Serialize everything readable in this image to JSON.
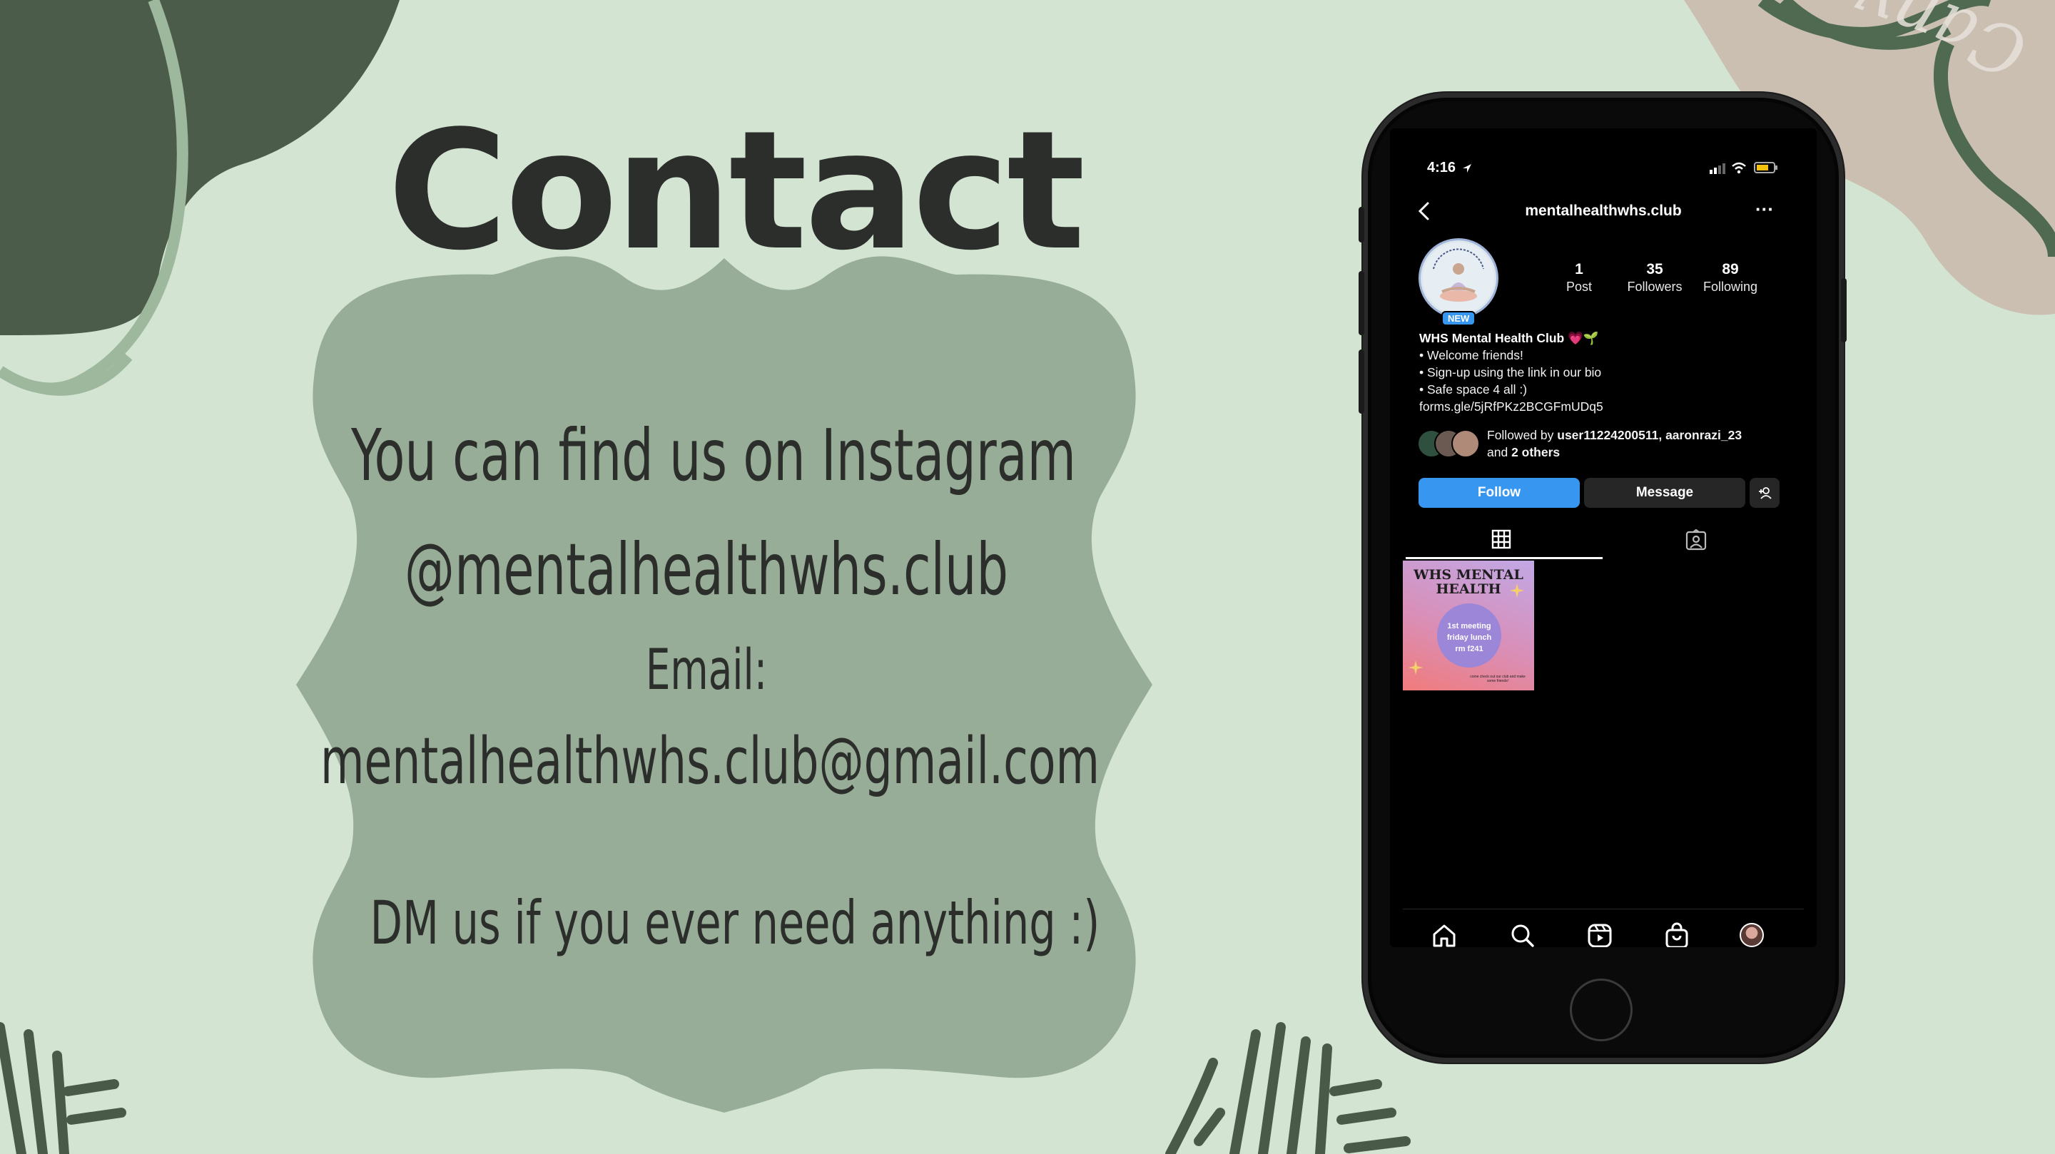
{
  "slide": {
    "title": "Contact",
    "line1": "You can find us on Instagram",
    "line2": "@mentalhealthwhs.club",
    "line3": "Email:",
    "line4": "mentalhealthwhs.club@gmail.com",
    "line5": "DM us if you ever need anything :)",
    "watermark": "Canva"
  },
  "phone": {
    "status": {
      "time": "4:16"
    },
    "header": {
      "username": "mentalhealthwhs.club",
      "more": "···"
    },
    "profile": {
      "avatar_text": "WHS Mental Health Club",
      "new_badge": "NEW",
      "stats": [
        {
          "value": "1",
          "label": "Post"
        },
        {
          "value": "35",
          "label": "Followers"
        },
        {
          "value": "89",
          "label": "Following"
        }
      ],
      "name": "WHS Mental Health Club 💗🌱",
      "bio": [
        "• Welcome friends!",
        "• Sign-up using the link in our bio",
        "• Safe space 4 all :)"
      ],
      "link": "forms.gle/5jRfPKz2BCGFmUDq5",
      "followed_prefix": "Followed by ",
      "followed_users": "user11224200511, aaronrazi_23",
      "followed_and": "and ",
      "followed_others": "2 others"
    },
    "buttons": {
      "follow": "Follow",
      "message": "Message"
    },
    "post": {
      "title": "WHS MENTAL HEALTH",
      "circle": [
        "1st meeting",
        "friday lunch",
        "rm f241"
      ],
      "footer": "come check out our club and make some friends!"
    }
  },
  "colors": {
    "background": "#d3e4d2",
    "frame": "#97ad97",
    "dark_blob": "#4c5c4b",
    "follow": "#3797f0",
    "message": "#262626"
  },
  "icons": [
    "back-icon",
    "more-icon",
    "grid-icon",
    "tagged-icon",
    "home-icon",
    "search-icon",
    "reels-icon",
    "shop-icon",
    "profile-icon"
  ]
}
